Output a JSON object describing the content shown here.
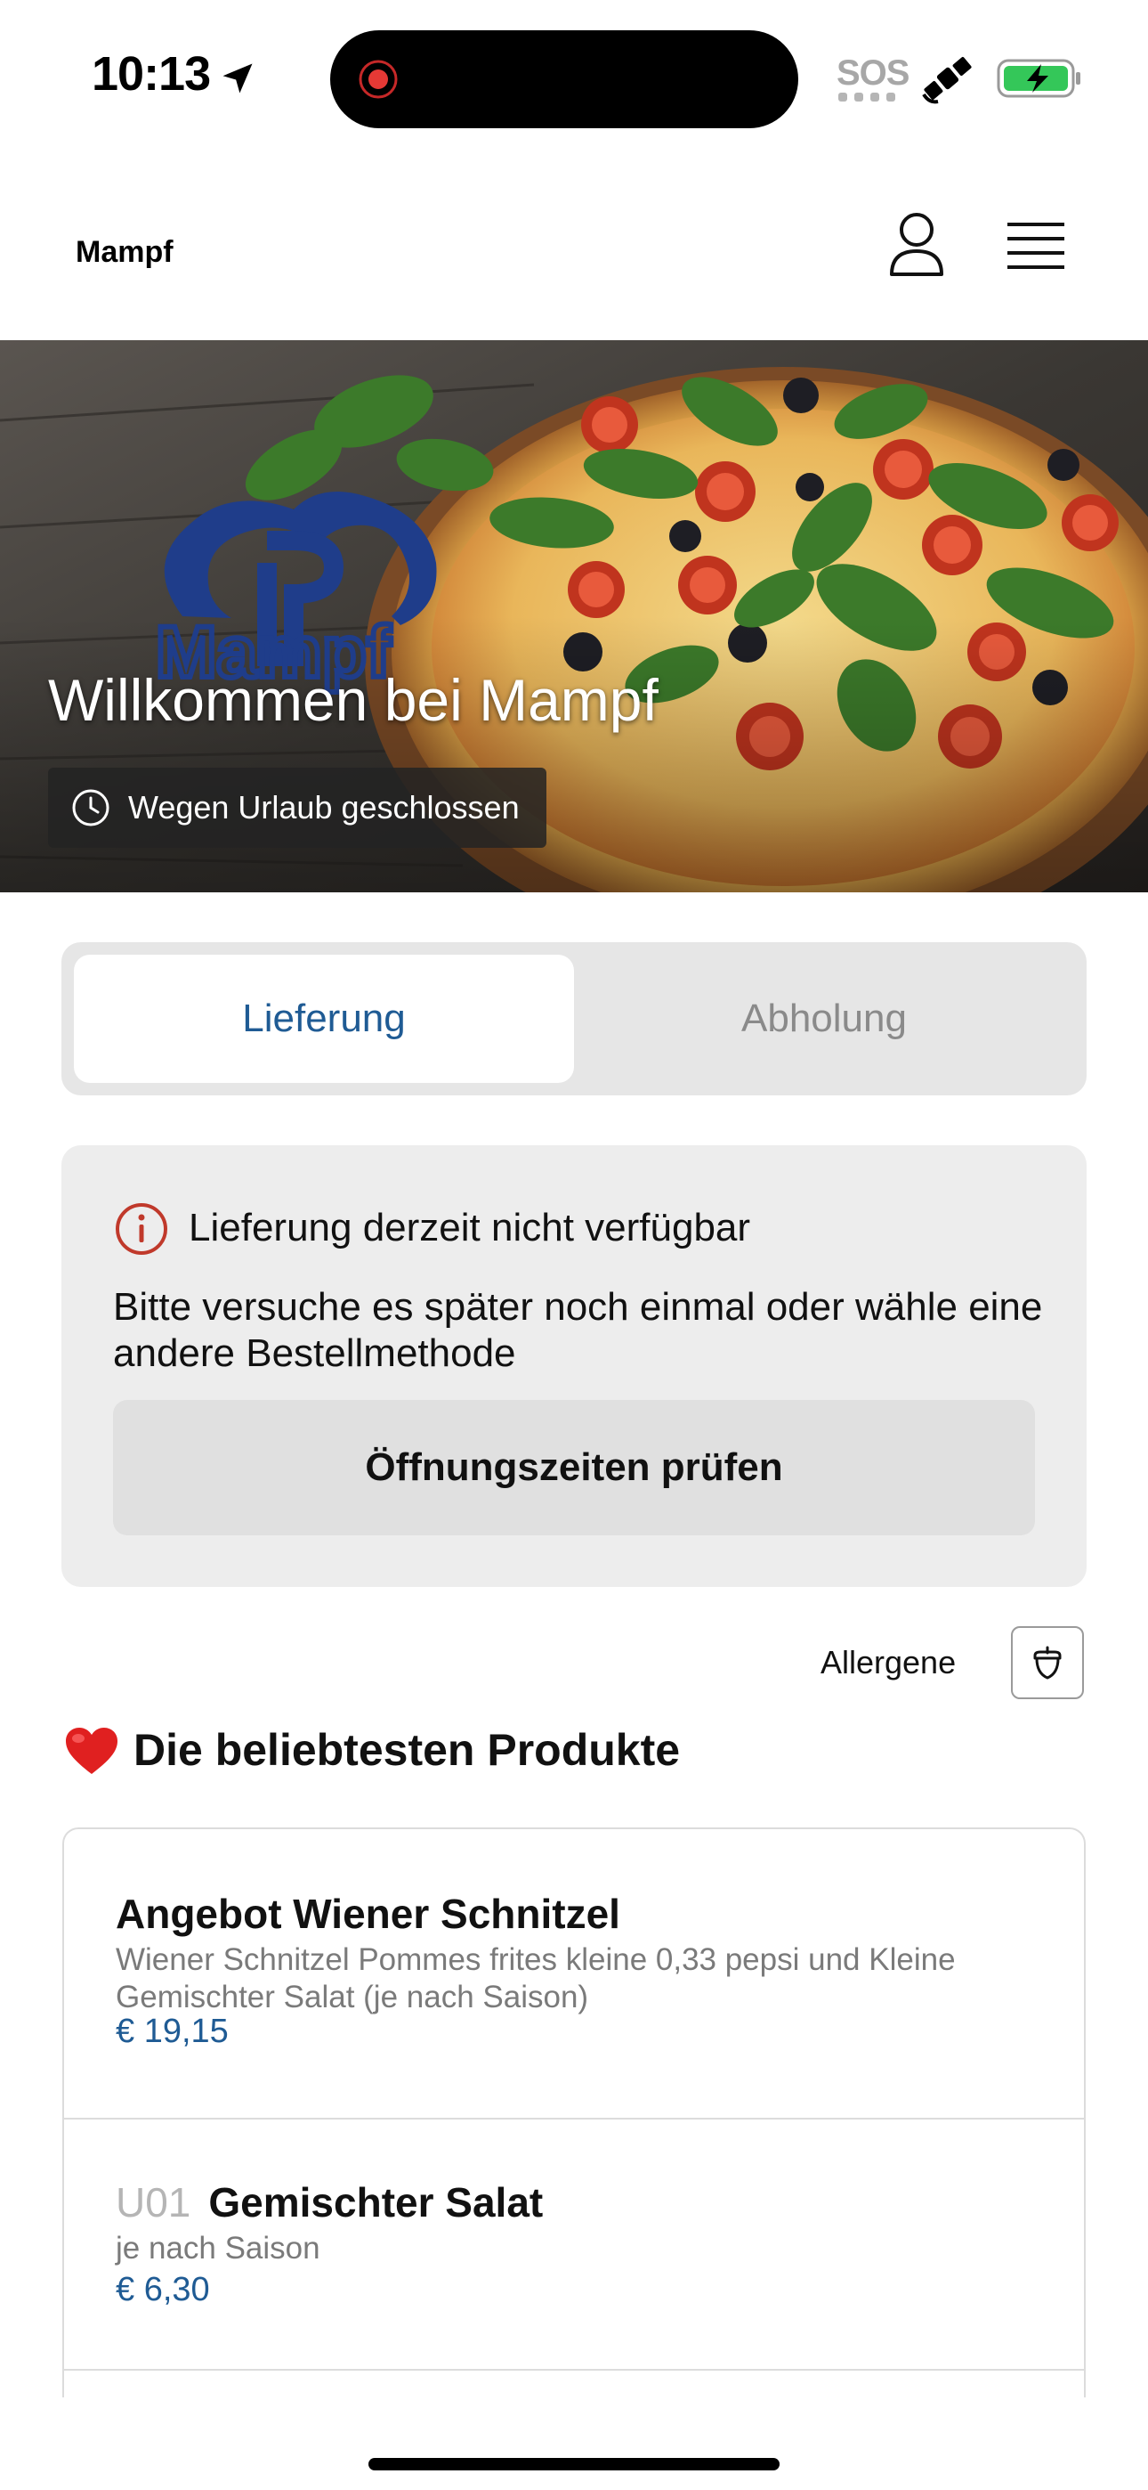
{
  "status_bar": {
    "time": "10:13",
    "sos": "SOS"
  },
  "header": {
    "brand": "Mampf"
  },
  "hero": {
    "title": "Willkommen bei Mampf",
    "status_badge": "Wegen Urlaub geschlossen",
    "logo_text": "Mampf"
  },
  "order_methods": {
    "tabs": [
      {
        "label": "Lieferung",
        "selected": true
      },
      {
        "label": "Abholung",
        "selected": false
      }
    ]
  },
  "notice": {
    "title": "Lieferung derzeit nicht verfügbar",
    "text": "Bitte versuche es später noch einmal oder wähle eine andere Bestellmethode",
    "button_label": "Öffnungszeiten prüfen"
  },
  "allergens": {
    "label": "Allergene"
  },
  "popular": {
    "title": "Die beliebtesten Produkte",
    "products": [
      {
        "code": "",
        "name": "Angebot Wiener Schnitzel",
        "description": "Wiener Schnitzel Pommes frites kleine 0,33 pepsi und Kleine Gemischter Salat (je nach Saison)",
        "price": "€ 19,15"
      },
      {
        "code": "U01",
        "name": "Gemischter Salat",
        "description": "je nach Saison",
        "price": "€ 6,30"
      }
    ]
  },
  "colors": {
    "accent": "#1f5b94",
    "notice_icon": "#c0392b",
    "heart": "#e02020",
    "battery": "#34c759"
  },
  "icons": {
    "location": "location-arrow-icon",
    "recording": "recording-dot-icon",
    "satellite": "satellite-icon",
    "battery": "battery-charging-icon",
    "user": "user-icon",
    "menu": "menu-icon",
    "clock": "clock-icon",
    "info": "info-icon",
    "allergen": "acorn-icon",
    "heart": "heart-icon"
  }
}
